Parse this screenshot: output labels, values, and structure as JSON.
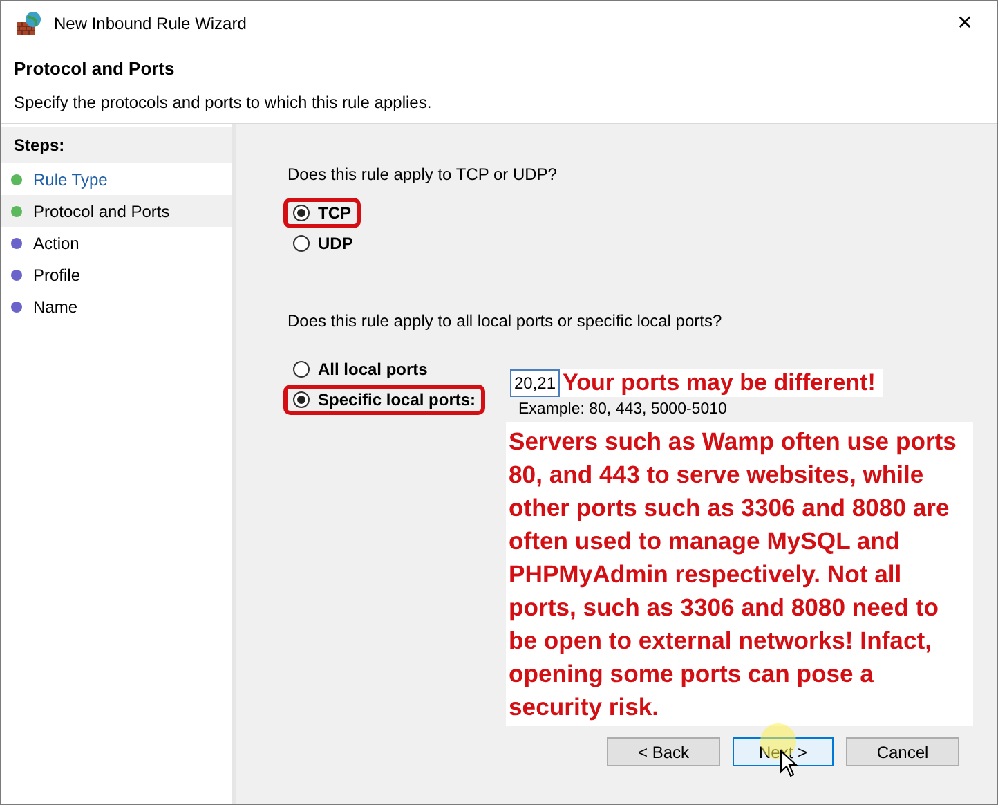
{
  "window": {
    "title": "New Inbound Rule Wizard",
    "close": "✕"
  },
  "header": {
    "title": "Protocol and Ports",
    "subtitle": "Specify the protocols and ports to which this rule applies."
  },
  "steps": {
    "heading": "Steps:",
    "items": [
      {
        "label": "Rule Type",
        "kind": "link",
        "selected": false,
        "color": "#5cb85c"
      },
      {
        "label": "Protocol and Ports",
        "kind": "plain",
        "selected": true,
        "color": "#5cb85c"
      },
      {
        "label": "Action",
        "kind": "plain",
        "selected": false,
        "color": "#6a63c9"
      },
      {
        "label": "Profile",
        "kind": "plain",
        "selected": false,
        "color": "#6a63c9"
      },
      {
        "label": "Name",
        "kind": "plain",
        "selected": false,
        "color": "#6a63c9"
      }
    ]
  },
  "protocol": {
    "question": "Does this rule apply to TCP or UDP?",
    "options": [
      {
        "label": "TCP",
        "selected": true,
        "kind": "boxed"
      },
      {
        "label": "UDP",
        "selected": false,
        "kind": "plain"
      }
    ]
  },
  "ports": {
    "question": "Does this rule apply to all local ports or specific local ports?",
    "options": [
      {
        "label": "All local ports",
        "selected": false,
        "kind": "plain"
      },
      {
        "label": "Specific local ports:",
        "selected": true,
        "kind": "boxed"
      }
    ],
    "value": "20,21",
    "example": "Example: 80, 443, 5000-5010"
  },
  "annotations": {
    "callout": "Your ports may be different!",
    "note": "Servers such as Wamp often use ports 80, and 443 to serve websites, while other ports such as 3306 and 8080 are often used to manage MySQL and PHPMyAdmin respectively. Not all ports, such as 3306 and 8080 need to be open to external networks! Infact, opening some ports can pose a security risk."
  },
  "buttons": [
    {
      "label": "< Back",
      "kind": "normal"
    },
    {
      "label": "Next >",
      "kind": "default"
    },
    {
      "label": "Cancel",
      "kind": "normal"
    }
  ]
}
